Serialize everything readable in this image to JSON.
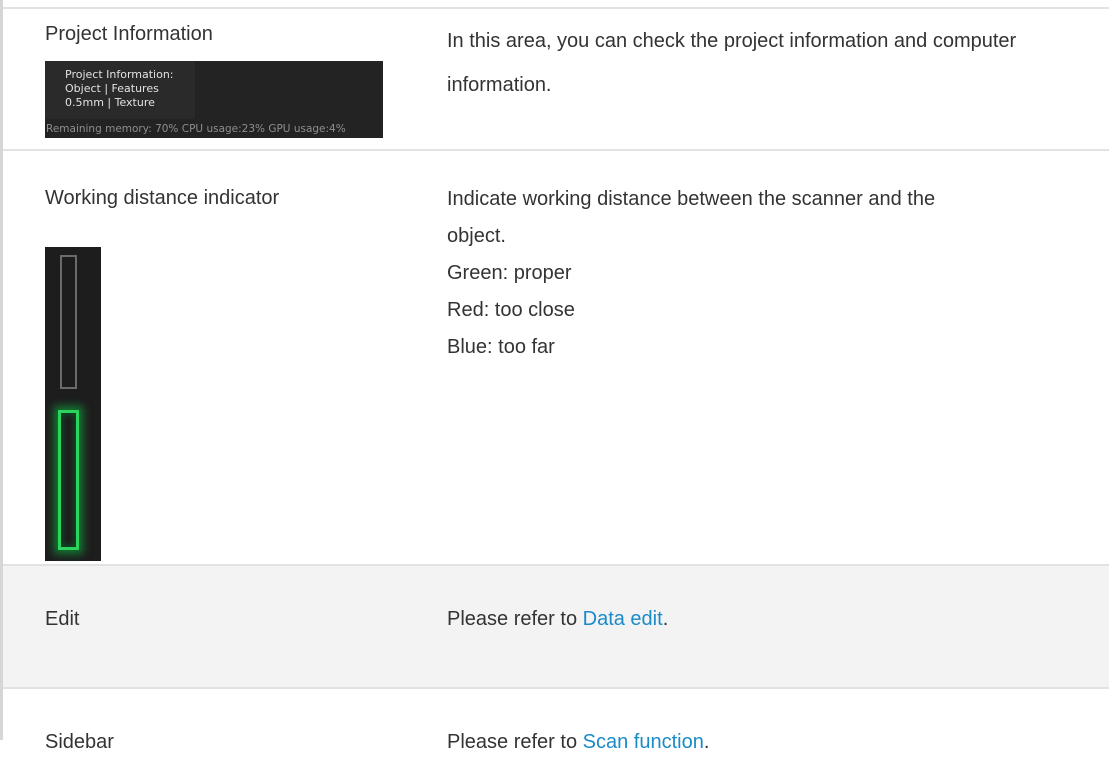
{
  "rows": [
    {
      "label": "Project Information",
      "description": "In this area, you can check the project information and computer information.",
      "panel": {
        "lines": [
          "Project Information:",
          "Object | Features",
          "0.5mm | Texture"
        ],
        "status": "Remaining memory: 70% CPU usage:23%  GPU usage:4%"
      }
    },
    {
      "label": "Working distance indicator",
      "description_lines": [
        "Indicate working distance between the scanner and the",
        "object.",
        "Green: proper",
        "Red: too close",
        "Blue: too far"
      ],
      "indicator": {
        "state": "proper",
        "active_color": "#2bd45d",
        "idle_color": "#6b6b6b"
      }
    },
    {
      "label": "Edit",
      "prefix": "Please refer to ",
      "link": "Data edit",
      "suffix": "."
    },
    {
      "label": "Sidebar",
      "prefix": "Please refer to ",
      "link": "Scan function",
      "suffix": "."
    }
  ],
  "colors": {
    "link": "#1a8ac9",
    "text": "#333333",
    "shaded_row": "#f3f3f3"
  }
}
